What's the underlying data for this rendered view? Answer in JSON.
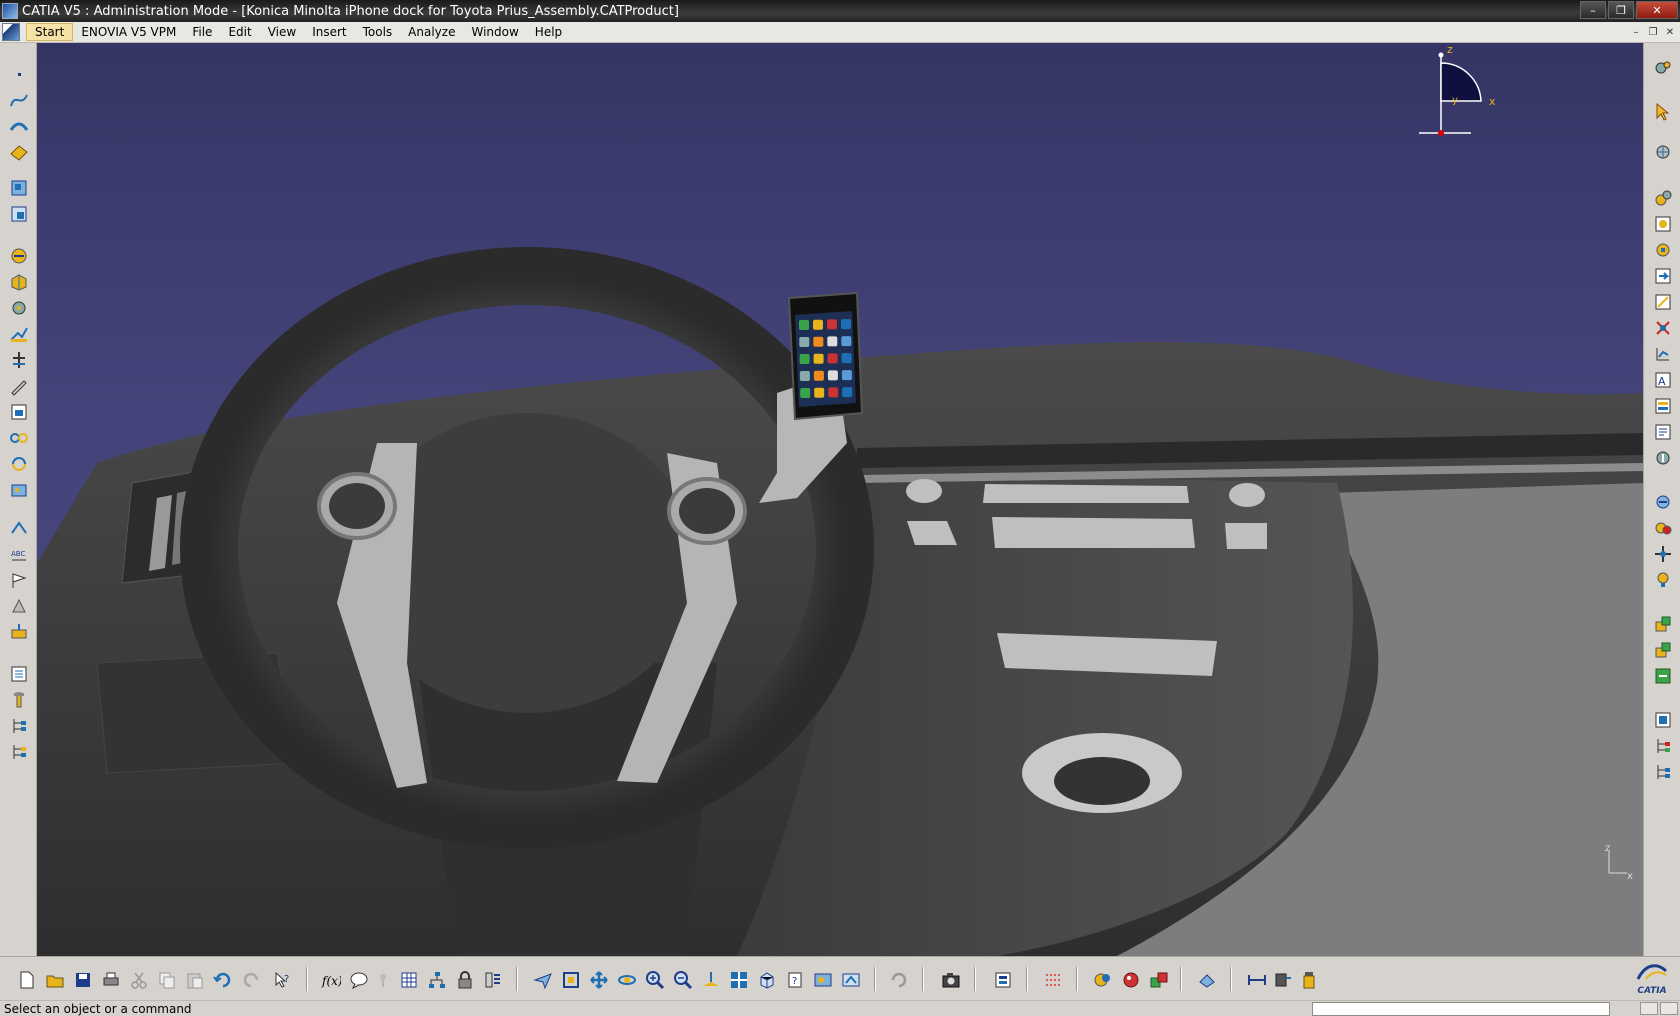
{
  "window": {
    "title": "CATIA V5 : Administration Mode - [Konica Minolta iPhone dock for Toyota Prius_Assembly.CATProduct]",
    "controls": [
      "–",
      "❐",
      "✕"
    ]
  },
  "menu": {
    "items": [
      {
        "label": "Start",
        "active": true
      },
      {
        "label": "ENOVIA V5 VPM"
      },
      {
        "label": "File"
      },
      {
        "label": "Edit"
      },
      {
        "label": "View"
      },
      {
        "label": "Insert"
      },
      {
        "label": "Tools"
      },
      {
        "label": "Analyze"
      },
      {
        "label": "Window"
      },
      {
        "label": "Help"
      }
    ],
    "doc_controls": [
      "–",
      "❐",
      "✕"
    ]
  },
  "compass": {
    "axis_z": "z",
    "axis_x": "x",
    "axis_y": "y"
  },
  "axis_triad": {
    "z": "z",
    "x": "x"
  },
  "colors": {
    "background_top": "#353565",
    "background_bottom": "#4a4a85",
    "toolbar": "#d6d3ce",
    "icon_accent": "#1f6fb5",
    "icon_yellow": "#e9b31c"
  },
  "status": {
    "text": "Select an object or a command",
    "command_value": ""
  },
  "logo": {
    "text": "CATIA"
  }
}
